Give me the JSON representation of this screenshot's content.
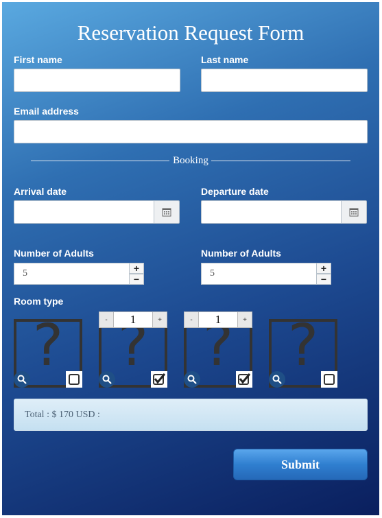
{
  "form": {
    "title": "Reservation Request Form",
    "first_name": {
      "label": "First name",
      "value": ""
    },
    "last_name": {
      "label": "Last name",
      "value": ""
    },
    "email": {
      "label": "Email address",
      "value": ""
    },
    "section_booking": "Booking",
    "arrival": {
      "label": "Arrival date",
      "value": "",
      "icon": "calendar-icon"
    },
    "departure": {
      "label": "Departure date",
      "value": "",
      "icon": "calendar-icon"
    },
    "adults_left": {
      "label": "Number of Adults",
      "value": "5",
      "plus": "+",
      "minus": "−"
    },
    "adults_right": {
      "label": "Number of Adults",
      "value": "5",
      "plus": "+",
      "minus": "−"
    },
    "room_type": {
      "label": "Room type",
      "rooms": [
        {
          "placeholder": "?",
          "checked": false,
          "qty": null
        },
        {
          "placeholder": "?",
          "checked": true,
          "qty": "1",
          "minus": "-",
          "plus": "+"
        },
        {
          "placeholder": "?",
          "checked": true,
          "qty": "1",
          "minus": "-",
          "plus": "+"
        },
        {
          "placeholder": "?",
          "checked": false,
          "qty": null
        }
      ]
    },
    "total": "Total : $ 170 USD :",
    "submit_label": "Submit"
  }
}
